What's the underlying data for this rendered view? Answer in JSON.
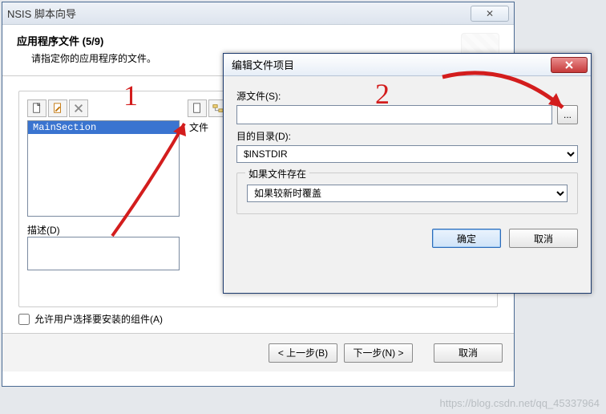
{
  "wizard": {
    "window_title": "NSIS 脚本向导",
    "header_title": "应用程序文件  (5/9)",
    "header_subtitle": "请指定你的应用程序的文件。",
    "sections": {
      "list_item": "MainSection"
    },
    "files_col_label": "文件",
    "desc_label": "描述(D)",
    "allow_user_select": "允许用户选择要安装的组件(A)",
    "btn_back": "< 上一步(B)",
    "btn_next": "下一步(N) >",
    "btn_cancel": "取消",
    "close_glyph": "✕"
  },
  "dialog": {
    "title": "编辑文件项目",
    "src_label": "源文件(S):",
    "src_value": "",
    "browse_label": "...",
    "dest_label": "目的目录(D):",
    "dest_value": "$INSTDIR",
    "group_legend": "如果文件存在",
    "overwrite_value": "如果较新时覆盖",
    "btn_ok": "确定",
    "btn_cancel": "取消"
  },
  "annotations": {
    "mark1": "1",
    "mark2": "2"
  },
  "watermark": "https://blog.csdn.net/qq_45337964"
}
